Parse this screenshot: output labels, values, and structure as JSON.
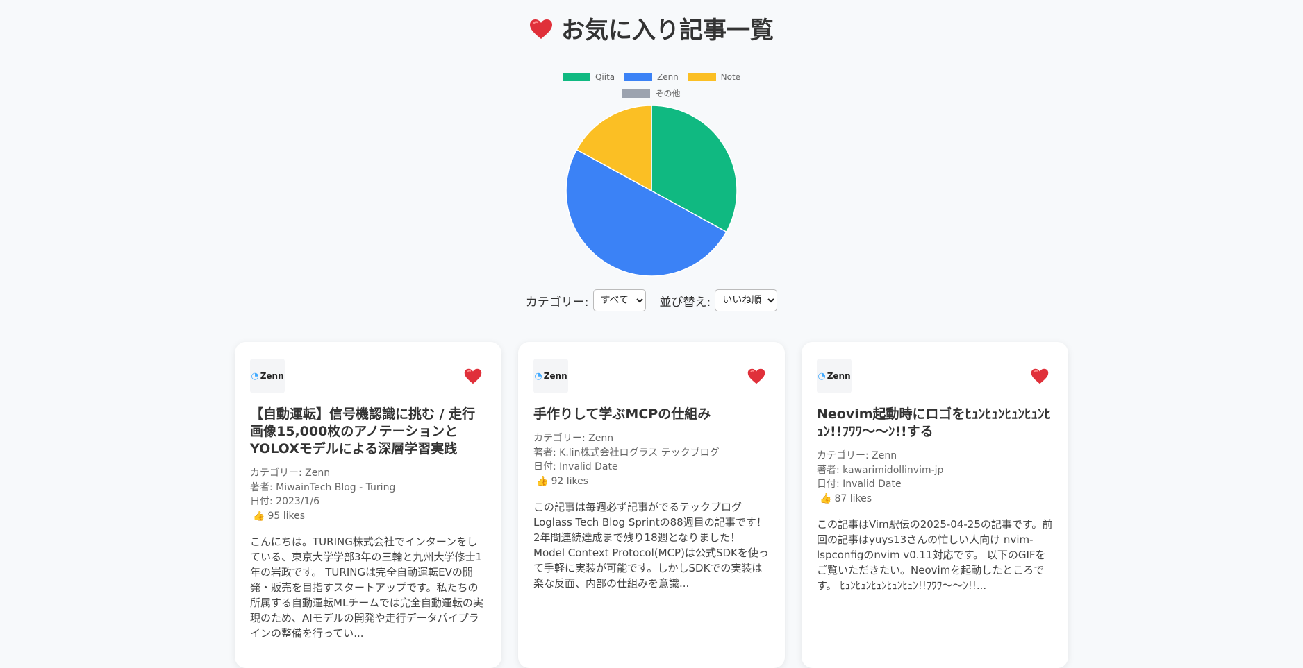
{
  "page": {
    "title": "お気に入り記事一覧",
    "heart_icon": "heart-icon"
  },
  "chart_data": {
    "type": "pie",
    "legend_position": "top",
    "categories": [
      "Qiita",
      "Zenn",
      "Note",
      "その他"
    ],
    "values": [
      33,
      50,
      17,
      0
    ],
    "colors": [
      "#10b981",
      "#3b82f6",
      "#fbbf24",
      "#9ca3af"
    ]
  },
  "filters": {
    "category_label": "カテゴリー:",
    "category_value": "すべて",
    "sort_label": "並び替え:",
    "sort_value": "いいね順"
  },
  "cards": [
    {
      "site": "Zenn",
      "title": "【自動運転】信号機認識に挑む / 走行画像15,000枚のアノテーションとYOLOXモデルによる深層学習実践",
      "category": "カテゴリー: Zenn",
      "author": "著者: MiwainTech Blog - Turing",
      "date": "日付: 2023/1/6",
      "likes": "95 likes",
      "description": "こんにちは。TURING株式会社でインターンをしている、東京大学学部3年の三輪と九州大学修士1年の岩政です。 TURINGは完全自動運転EVの開発・販売を目指すスタートアップです。私たちの所属する自動運転MLチームでは完全自動運転の実現のため、AIモデルの開発や走行データパイプラインの整備を行ってい..."
    },
    {
      "site": "Zenn",
      "title": "手作りして学ぶMCPの仕組み",
      "category": "カテゴリー: Zenn",
      "author": "著者: K.lin株式会社ログラス テックブログ",
      "date": "日付: Invalid Date",
      "likes": "92 likes",
      "description": "この記事は毎週必ず記事がでるテックブログ Loglass Tech Blog Sprintの88週目の記事です！2年間連続達成まで残り18週となりました！ Model Context Protocol(MCP)は公式SDKを使って手軽に実装が可能です。しかしSDKでの実装は楽な反面、内部の仕組みを意識..."
    },
    {
      "site": "Zenn",
      "title": "Neovim起動時にロゴをﾋｭﾝﾋｭﾝﾋｭﾝﾋｭﾝﾋｭﾝ!!ﾌﾜﾜ～～ﾝ!!する",
      "category": "カテゴリー: Zenn",
      "author": "著者: kawarimidollinvim-jp",
      "date": "日付: Invalid Date",
      "likes": "87 likes",
      "description": "この記事はVim駅伝の2025-04-25の記事です。前回の記事はyuys13さんの忙しい人向け nvim-lspconfigのnvim v0.11対応です。 以下のGIFをご覧いただきたい。Neovimを起動したところです。 ﾋｭﾝﾋｭﾝﾋｭﾝﾋｭﾝﾋｭﾝ!!ﾌﾜﾜ～～ﾝ!!..."
    }
  ]
}
